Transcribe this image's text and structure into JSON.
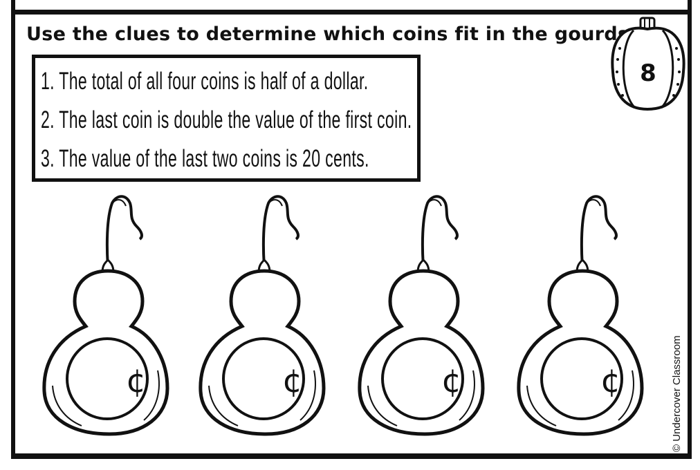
{
  "instruction": "Use the clues to determine which coins fit in the gourds.",
  "badge_number": "8",
  "clues": [
    "1. The total of all four coins is half of a dollar.",
    "2. The last coin is double the value of the first coin.",
    "3. The value of the last two coins is 20 cents."
  ],
  "gourds": [
    {
      "label": "¢"
    },
    {
      "label": "¢"
    },
    {
      "label": "¢"
    },
    {
      "label": "¢"
    }
  ],
  "credit": "© Undercover Classroom"
}
